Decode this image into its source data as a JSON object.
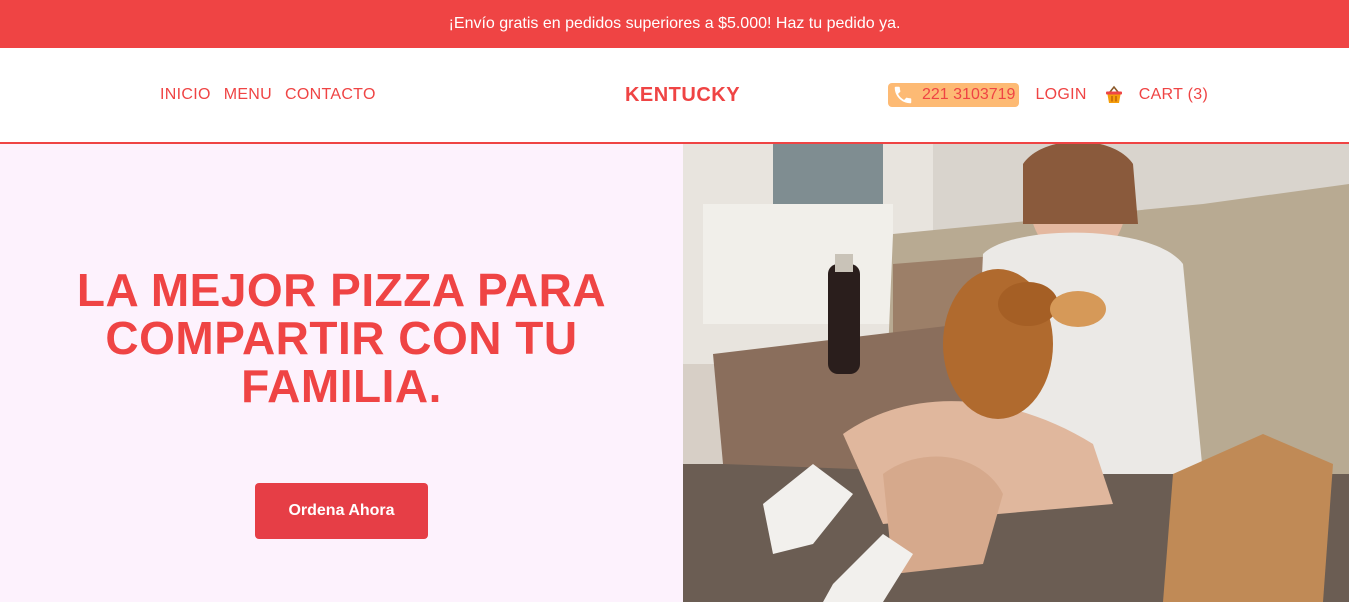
{
  "promo": {
    "text": "¡Envío gratis en pedidos superiores a $5.000! Haz tu pedido ya."
  },
  "nav": {
    "links": [
      "INICIO",
      "MENU",
      "CONTACTO"
    ],
    "brand": "KENTUCKY",
    "phone": "221 3103719",
    "phone_icon": "phone-icon",
    "login": "LOGIN",
    "cart_icon": "basket-icon",
    "cart": "CART (3)"
  },
  "hero": {
    "title": "LA MEJOR PIZZA PARA COMPARTIR CON TU FAMILIA.",
    "cta": "Ordena Ahora"
  },
  "colors": {
    "primary": "#ef4444",
    "hero_bg": "#fdf2fd",
    "phone_bg": "#fdba74"
  }
}
